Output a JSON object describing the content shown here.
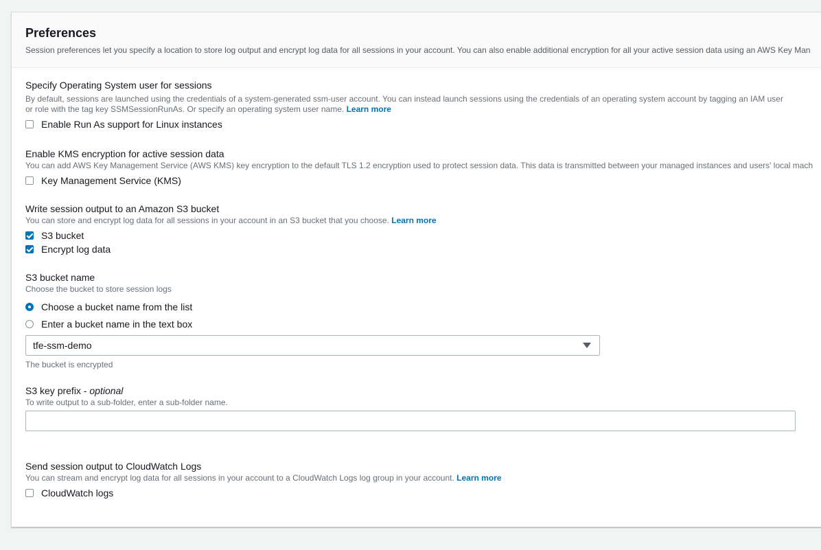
{
  "header": {
    "title": "Preferences",
    "description": "Session preferences let you specify a location to store log output and encrypt log data for all sessions in your account. You can also enable additional encryption for all your active session data using an AWS Key Man"
  },
  "run_as": {
    "label": "Specify Operating System user for sessions",
    "description_line1": "By default, sessions are launched using the credentials of a system-generated ssm-user account. You can instead launch sessions using the credentials of an operating system account by tagging an IAM user",
    "description_line2": "or role with the tag key SSMSessionRunAs. Or specify an operating system user name.",
    "learn_more": "Learn more",
    "checkbox_label": "Enable Run As support for Linux instances",
    "checked": false
  },
  "kms": {
    "label": "Enable KMS encryption for active session data",
    "description": "You can add AWS Key Management Service (AWS KMS) key encryption to the default TLS 1.2 encryption used to protect session data. This data is transmitted between your managed instances and users' local mach",
    "checkbox_label": "Key Management Service (KMS)",
    "checked": false
  },
  "s3": {
    "label": "Write session output to an Amazon S3 bucket",
    "description": "You can store and encrypt log data for all sessions in your account in an S3 bucket that you choose.",
    "learn_more": "Learn more",
    "s3_checkbox_label": "S3 bucket",
    "s3_checked": true,
    "encrypt_checkbox_label": "Encrypt log data",
    "encrypt_checked": true
  },
  "bucket_name": {
    "label": "S3 bucket name",
    "description": "Choose the bucket to store session logs",
    "radio_list_label": "Choose a bucket name from the list",
    "radio_text_label": "Enter a bucket name in the text box",
    "selected_option": "list",
    "selected_bucket": "tfe-ssm-demo",
    "hint": "The bucket is encrypted"
  },
  "key_prefix": {
    "label": "S3 key prefix - ",
    "label_optional": "optional",
    "description": "To write output to a sub-folder, enter a sub-folder name.",
    "value": ""
  },
  "cloudwatch": {
    "label": "Send session output to CloudWatch Logs",
    "description": "You can stream and encrypt log data for all sessions in your account to a CloudWatch Logs log group in your account.",
    "learn_more": "Learn more",
    "checkbox_label": "CloudWatch logs",
    "checked": false
  },
  "colors": {
    "accent": "#0073bb",
    "text": "#16191f",
    "muted": "#687078"
  }
}
